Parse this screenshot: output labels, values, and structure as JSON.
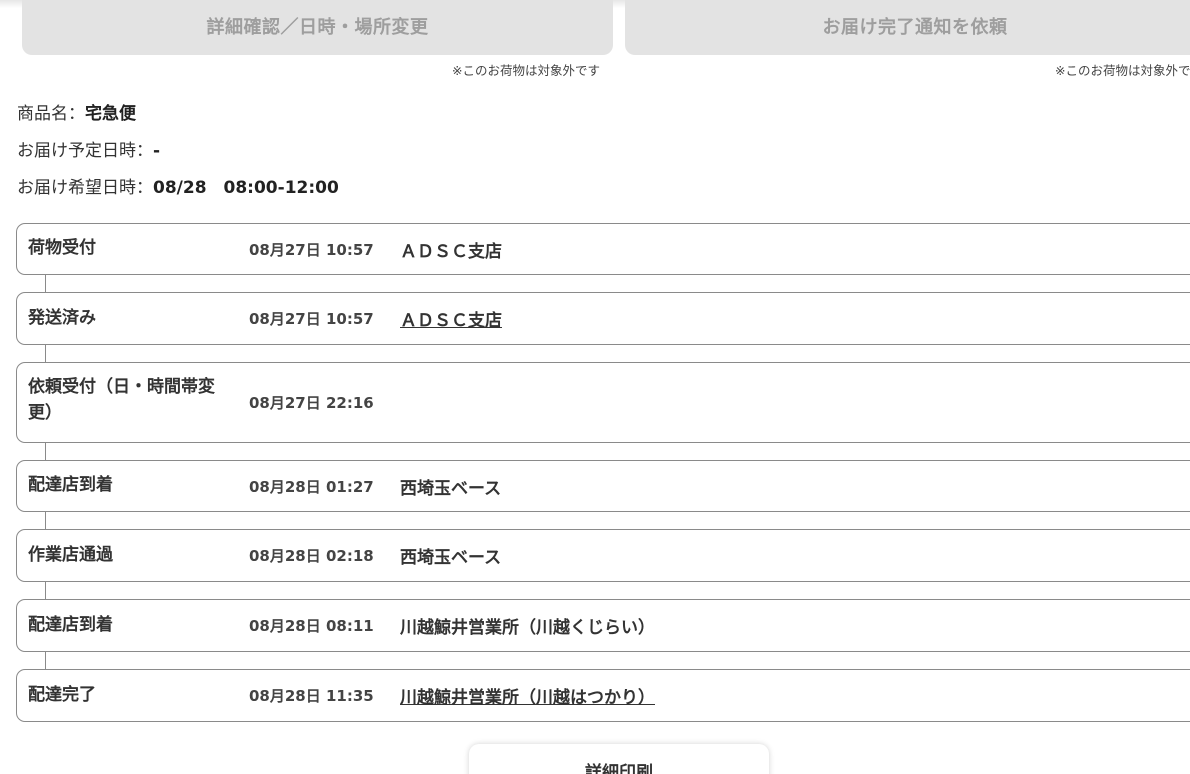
{
  "actions": {
    "detail_change_label": "詳細確認／日時・場所変更",
    "completion_notice_label": "お届け完了通知を依頼",
    "detail_change_note": "※このお荷物は対象外です",
    "completion_notice_note": "※このお荷物は対象外です"
  },
  "info": {
    "product_label": "商品名：",
    "product_value": "宅急便",
    "scheduled_label": "お届け予定日時：",
    "scheduled_value": "-",
    "requested_label": "お届け希望日時：",
    "requested_value": "08/28　08:00-12:00"
  },
  "tracking": [
    {
      "status": "荷物受付",
      "time": "08月27日 10:57",
      "place": "ＡＤＳＣ支店"
    },
    {
      "status": "発送済み",
      "time": "08月27日 10:57",
      "place": "ＡＤＳＣ支店"
    },
    {
      "status": "依頼受付（日・時間帯変更）",
      "time": "08月27日 22:16",
      "place": ""
    },
    {
      "status": "配達店到着",
      "time": "08月28日 01:27",
      "place": "西埼玉ベース"
    },
    {
      "status": "作業店通過",
      "time": "08月28日 02:18",
      "place": "西埼玉ベース"
    },
    {
      "status": "配達店到着",
      "time": "08月28日 08:11",
      "place": "川越鯨井営業所（川越くじらい）"
    },
    {
      "status": "配達完了",
      "time": "08月28日 11:35",
      "place": "川越鯨井営業所（川越はつかり）"
    }
  ],
  "print": {
    "label": "詳細印刷"
  },
  "colors": {
    "disabled_button_bg": "#e3e3e3",
    "disabled_button_text": "#9e9e9e",
    "row_border": "#8a8a8a"
  }
}
